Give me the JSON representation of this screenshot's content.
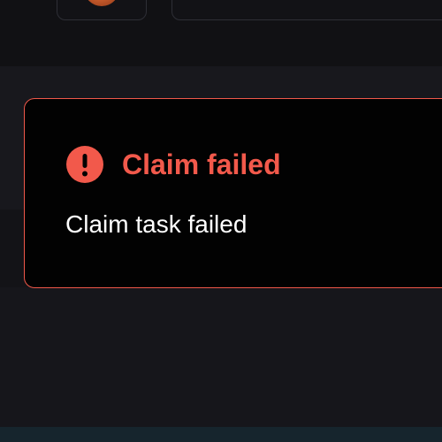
{
  "toast": {
    "icon": "exclamation-circle-icon",
    "title": "Claim failed",
    "message": "Claim task failed"
  },
  "colors": {
    "error_accent": "#f2594b",
    "toast_background": "#020202",
    "page_background": "#16161b",
    "message_text": "#ffffff"
  }
}
